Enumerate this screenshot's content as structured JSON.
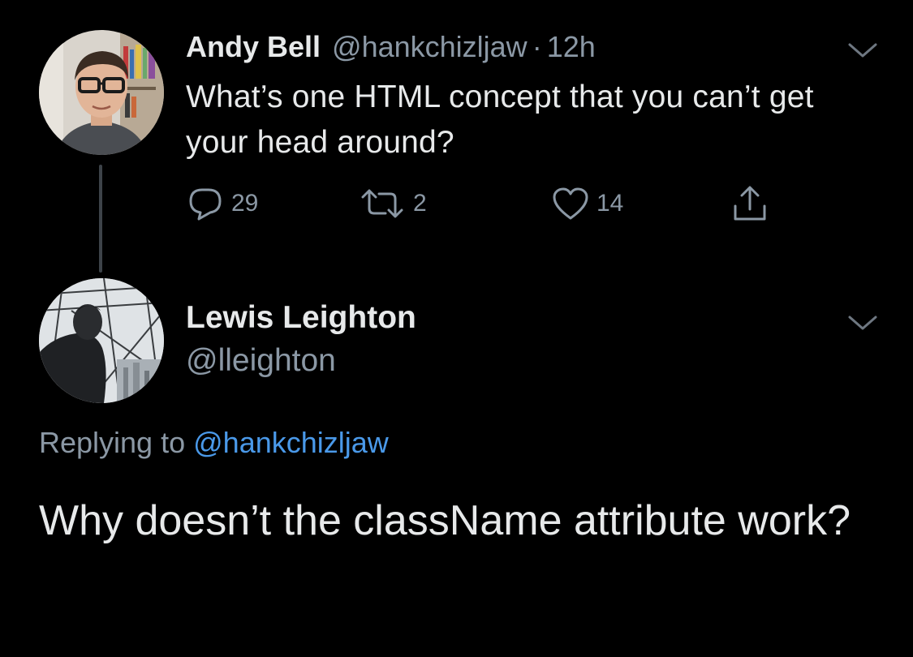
{
  "parent_tweet": {
    "author_name": "Andy Bell",
    "handle": "@hankchizljaw",
    "separator": "·",
    "time": "12h",
    "text": "What’s one HTML concept that you can’t get your head around?",
    "counts": {
      "replies": "29",
      "retweets": "2",
      "likes": "14"
    }
  },
  "reply_tweet": {
    "author_name": "Lewis Leighton",
    "handle": "@lleighton",
    "replying_prefix": "Replying to",
    "replying_mention": "@hankchizljaw",
    "text": "Why doesn’t the className attribute work?"
  },
  "icons": {
    "reply": "comment-bubble-icon",
    "retweet": "retweet-icon",
    "like": "heart-icon",
    "share": "share-upload-icon",
    "menu": "chevron-down-icon"
  },
  "colors": {
    "background": "#000000",
    "primary_text": "#e7e9ea",
    "secondary_text": "#8b98a5",
    "link": "#4a99e9",
    "thread_line": "#3d4349"
  }
}
